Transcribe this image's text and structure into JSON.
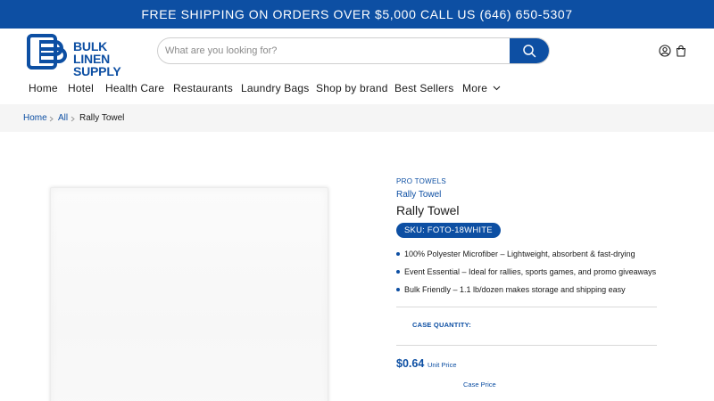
{
  "announcement": "FREE SHIPPING ON ORDERS OVER $5,000 CALL US (646) 650-5307",
  "header": {
    "logo_line1": "BULK LINEN",
    "logo_line2": "SUPPLY",
    "search_placeholder": "What are you looking for?",
    "icons": [
      "search-icon",
      "account-icon",
      "cart-icon"
    ]
  },
  "nav": {
    "items": [
      "Home",
      "Hotel",
      "Health Care",
      "Restaurants",
      "Laundry Bags",
      "Shop by brand",
      "Best Sellers",
      "More"
    ]
  },
  "breadcrumb": {
    "items": [
      "Home",
      "All",
      "Rally Towel"
    ]
  },
  "product": {
    "vendor": "PRO TOWELS",
    "subtitle": "Rally Towel",
    "title": "Rally Towel",
    "sku": "SKU: FOTO-18WHITE",
    "features": [
      "100% Polyester Microfiber – Lightweight, absorbent & fast-drying",
      "Event Essential – Ideal for rallies, sports games, and promo giveaways",
      "Bulk Friendly – 1.1 lb/dozen makes storage and shipping easy"
    ],
    "case_quantity_label": "CASE QUANTITY:",
    "price": "$0.64",
    "unit_price_label": "Unit Price",
    "case_price_label": "Case Price"
  },
  "colors": {
    "brand": "#0d4fa3",
    "breadcrumb_bg": "#f5f5f5"
  }
}
